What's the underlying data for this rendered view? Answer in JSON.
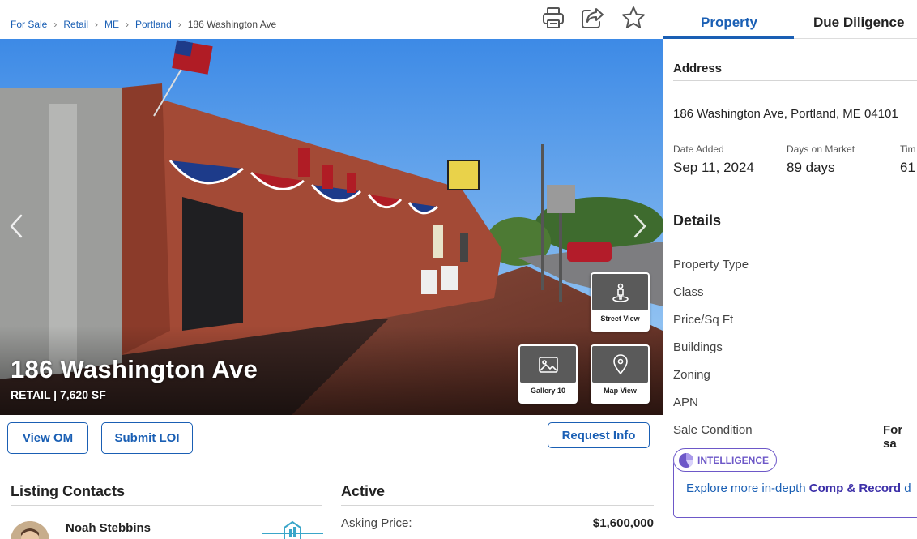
{
  "breadcrumb": {
    "items": [
      "For Sale",
      "Retail",
      "ME",
      "Portland",
      "186 Washington Ave"
    ]
  },
  "toolbar": {
    "icons": [
      "print-icon",
      "share-icon",
      "favorite-star-icon"
    ]
  },
  "hero": {
    "title": "186 Washington Ave",
    "subtitle": "RETAIL | 7,620 SF",
    "tiles": {
      "street_view": "Street View",
      "gallery": "Gallery 10",
      "map_view": "Map View"
    }
  },
  "actions": {
    "view_om": "View OM",
    "submit_loi": "Submit LOI",
    "request_info": "Request Info"
  },
  "listing_contacts": {
    "title": "Listing Contacts",
    "contact_name": "Noah Stebbins"
  },
  "status": {
    "title": "Active",
    "asking_label": "Asking Price:",
    "asking_value": "$1,600,000"
  },
  "panel": {
    "tabs": [
      "Property",
      "Due Diligence"
    ],
    "active_tab": "Property",
    "address_heading": "Address",
    "address": "186 Washington Ave, Portland, ME 04101",
    "stats": [
      {
        "label": "Date Added",
        "value": "Sep 11, 2024"
      },
      {
        "label": "Days on Market",
        "value": "89 days"
      },
      {
        "label": "Tim",
        "value": "61"
      }
    ],
    "details_heading": "Details",
    "details": [
      "Property Type",
      "Class",
      "Price/Sq Ft",
      "Buildings",
      "Zoning",
      "APN",
      "Sale Condition"
    ],
    "sale_condition_value": "For sa",
    "intelligence": {
      "badge": "INTELLIGENCE",
      "text_pre": "Explore more in-depth ",
      "text_bold": "Comp & Record",
      "text_post": " d"
    }
  },
  "colors": {
    "accent": "#1a5fb4",
    "intelligence": "#6d58c8"
  }
}
